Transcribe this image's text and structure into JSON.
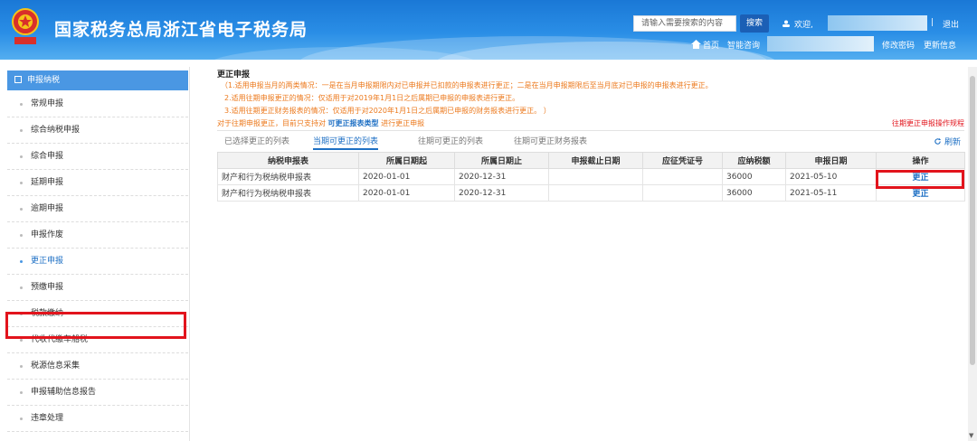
{
  "header": {
    "title": "国家税务总局浙江省电子税务局",
    "search_placeholder": "请输入需要搜索的内容",
    "search_button": "搜索",
    "welcome": "欢迎,",
    "separator": "|",
    "logout": "退出",
    "nav_home": "首页",
    "nav_consult": "智能咨询",
    "nav_change_password": "修改密码",
    "nav_update_info": "更新信息"
  },
  "sidebar": {
    "section_title": "申报纳税",
    "items": [
      {
        "label": "常规申报"
      },
      {
        "label": "综合纳税申报"
      },
      {
        "label": "综合申报"
      },
      {
        "label": "延期申报"
      },
      {
        "label": "逾期申报"
      },
      {
        "label": "申报作废"
      },
      {
        "label": "更正申报"
      },
      {
        "label": "预缴申报"
      },
      {
        "label": "税款缴纳"
      },
      {
        "label": "代收代缴车船税"
      },
      {
        "label": "税源信息采集"
      },
      {
        "label": "申报辅助信息报告"
      },
      {
        "label": "违章处理"
      }
    ],
    "active_item": "更正申报"
  },
  "main": {
    "heading": "更正申报",
    "notes": [
      "（1.适用申报当月的两类情况：一是在当月申报期限内对已申报并已扣款的申报表进行更正；二是在当月申报期限后至当月底对已申报的申报表进行更正。",
      "2.适用往期申报更正的情况：仅适用于对2019年1月1日之后属期已申报的申报表进行更正。",
      "3.适用往期更正财务报表的情况：仅适用于对2020年1月1日之后属期已申报的财务报表进行更正。  ）"
    ],
    "note_tail_prefix": "对于往期申报更正，目前只支持对",
    "note_tail_link": "可更正报表类型",
    "note_tail_suffix": "进行更正申报",
    "ops_guide_link": "往期更正申报操作规程",
    "tabs": [
      {
        "label": "已选择更正的列表"
      },
      {
        "label": "当期可更正的列表"
      },
      {
        "label": "往期可更正的列表"
      },
      {
        "label": "往期可更正财务报表"
      }
    ],
    "active_tab": "当期可更正的列表",
    "refresh": "刷新",
    "table": {
      "columns": [
        "纳税申报表",
        "所属日期起",
        "所属日期止",
        "申报截止日期",
        "应征凭证号",
        "应纳税额",
        "申报日期",
        "操作"
      ],
      "rows": [
        [
          "财产和行为税纳税申报表",
          "2020-01-01",
          "2020-12-31",
          "",
          "",
          "36000",
          "2021-05-10",
          "更正"
        ],
        [
          "财产和行为税纳税申报表",
          "2020-01-01",
          "2020-12-31",
          "",
          "",
          "36000",
          "2021-05-11",
          "更正"
        ]
      ]
    }
  },
  "colors": {
    "header_blue": "#1a78d6",
    "link_blue": "#1d6fc4",
    "note_orange": "#ec7a1e",
    "highlight_red": "#e2141c"
  },
  "icons": [
    "emblem-icon",
    "home-icon",
    "user-icon",
    "refresh-icon",
    "box-icon"
  ]
}
